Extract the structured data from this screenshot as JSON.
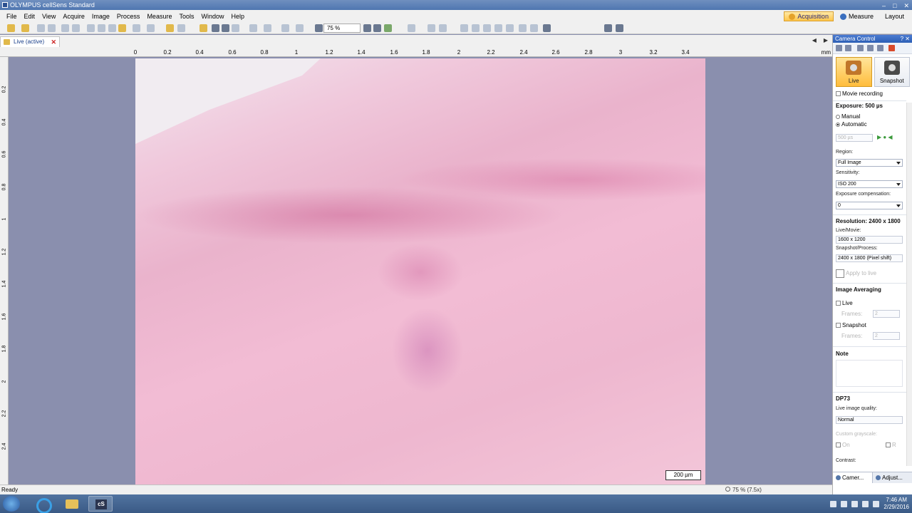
{
  "window": {
    "title": "OLYMPUS cellSens Standard"
  },
  "menu": [
    "File",
    "Edit",
    "View",
    "Acquire",
    "Image",
    "Process",
    "Measure",
    "Tools",
    "Window",
    "Help"
  ],
  "layouts": [
    "Acquisition",
    "Measure",
    "Layout"
  ],
  "toolbar": {
    "zoom": "75 %"
  },
  "document_tab": {
    "label": "Live (active)"
  },
  "ruler": {
    "h_ticks": [
      "0",
      "0.2",
      "0.4",
      "0.6",
      "0.8",
      "1",
      "1.2",
      "1.4",
      "1.6",
      "1.8",
      "2",
      "2.2",
      "2.4",
      "2.6",
      "2.8",
      "3",
      "3.2",
      "3.4"
    ],
    "h_unit": "mm",
    "v_ticks": [
      "0.2",
      "0.4",
      "0.6",
      "0.8",
      "1",
      "1.2",
      "1.4",
      "1.6",
      "1.8",
      "2",
      "2.2",
      "2.4"
    ]
  },
  "image": {
    "scalebar": "200 µm"
  },
  "status": {
    "left": "Ready",
    "zoom": "75 % (7.5x)"
  },
  "panel": {
    "title": "Camera Control",
    "live_label": "Live",
    "snapshot_label": "Snapshot",
    "movie_recording": "Movie recording",
    "exposure_title": "Exposure: 500 µs",
    "manual": "Manual",
    "automatic": "Automatic",
    "exposure_value": "500 µs",
    "region_label": "Region:",
    "region_value": "Full Image",
    "sensitivity_label": "Sensitivity:",
    "sensitivity_value": "ISO 200",
    "exp_comp_label": "Exposure compensation:",
    "exp_comp_value": "0",
    "resolution_title": "Resolution: 2400 x 1800",
    "live_movie_label": "Live/Movie:",
    "live_movie_value": "1600 x 1200",
    "snapshot_process_label": "Snapshot/Process:",
    "snapshot_process_value": "2400 x 1800 (Pixel shift)",
    "apply_label": "Apply to live",
    "averaging_title": "Image Averaging",
    "avg_live": "Live",
    "frames_label": "Frames:",
    "frames_live": "2",
    "avg_snapshot": "Snapshot",
    "frames_snapshot": "2",
    "note_title": "Note",
    "device_title": "DP73",
    "live_quality_label": "Live image quality:",
    "live_quality_value": "Normal",
    "custom_grayscale": "Custom grayscale:",
    "on_label": "On",
    "r_label": "R",
    "contrast_label": "Contrast:",
    "tab_camera": "Camer...",
    "tab_adjust": "Adjust..."
  },
  "taskbar": {
    "time": "7:46 AM",
    "date": "2/29/2016"
  }
}
